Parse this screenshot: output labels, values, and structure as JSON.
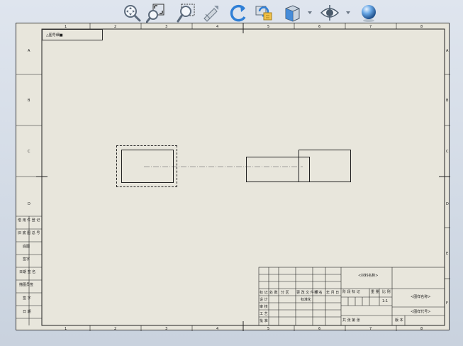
{
  "toolbar": {
    "tools": [
      {
        "name": "zoom-to-fit-icon"
      },
      {
        "name": "zoom-to-area-icon"
      },
      {
        "name": "zoom-in-out-icon"
      },
      {
        "name": "pan-icon"
      },
      {
        "name": "rotate-icon"
      },
      {
        "name": "redraw-icon"
      },
      {
        "name": "view-orientation-icon"
      },
      {
        "name": "hide-show-icon"
      },
      {
        "name": "appearance-icon"
      }
    ],
    "accent": "#2f7fd6"
  },
  "sheet": {
    "corner_label": "△图号细■",
    "zone_numbers_top": [
      "1",
      "2",
      "3",
      "4",
      "5",
      "6",
      "7",
      "8"
    ],
    "zone_letters_right": [
      "A",
      "B",
      "C",
      "D",
      "E",
      "F"
    ],
    "left_panel_labels": [
      "借 用 件 登 记",
      "旧 底 图 总 号",
      "底图",
      "签字",
      "日期 签 名",
      "描图员签",
      "签 字",
      "日 期"
    ],
    "title_block": {
      "company": "<材料名称>",
      "headers": [
        "标 记",
        "处 数",
        "分 区",
        "更 改 文 件 号",
        "签 名",
        "年 月 日"
      ],
      "rows": [
        "设 计",
        "审 核",
        "工 艺",
        "批 准"
      ],
      "mid": [
        "标准化",
        "",
        "",
        ""
      ],
      "stage": [
        "阶 段 标 记",
        "重 量",
        "比 例"
      ],
      "scale": "1:1",
      "drawing_name": "<图样名称>",
      "drawing_number": "<图样代号>",
      "sheet": "共 张 第 张",
      "version": "版 本"
    }
  },
  "colors": {
    "sheet_bg": "#e8e6dc",
    "line": "#222222",
    "centerline": "#888888"
  }
}
